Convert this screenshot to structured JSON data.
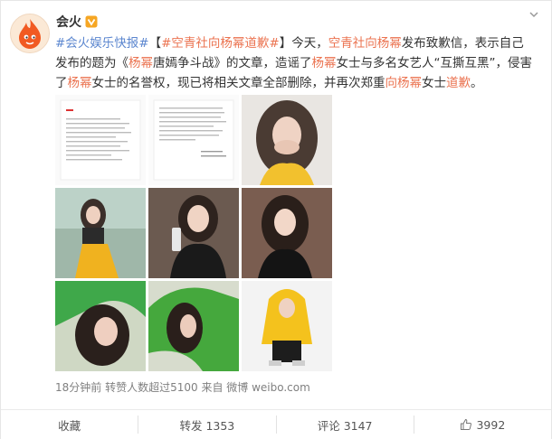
{
  "post": {
    "username": "会火",
    "text_segments": [
      {
        "t": "#会火娱乐快报#",
        "cls": "tag blue"
      },
      {
        "t": "【",
        "cls": ""
      },
      {
        "t": "#空青社向杨幂道歉#",
        "cls": "tag"
      },
      {
        "t": "】今天，",
        "cls": ""
      },
      {
        "t": "空青社向杨幂",
        "cls": "hl-link"
      },
      {
        "t": "发布致歉信，表示自己发布的题为《",
        "cls": ""
      },
      {
        "t": "杨幂",
        "cls": "hl-link"
      },
      {
        "t": "唐嫣争斗战》的文章，造谣了",
        "cls": ""
      },
      {
        "t": "杨幂",
        "cls": "hl-link"
      },
      {
        "t": "女士与多名女艺人“互撕互黑”，侵害了",
        "cls": ""
      },
      {
        "t": "杨幂",
        "cls": "hl-link"
      },
      {
        "t": "女士的名誉权，现已将相关文章全部删除，并再次郑重",
        "cls": ""
      },
      {
        "t": "向杨幂",
        "cls": "hl-link"
      },
      {
        "t": "女士",
        "cls": ""
      },
      {
        "t": "道歉",
        "cls": "hl-link"
      },
      {
        "t": "。",
        "cls": ""
      }
    ],
    "meta": "18分钟前 转赞人数超过5100 来自 微博 weibo.com",
    "images": [
      {
        "name": "image-letter-page-1"
      },
      {
        "name": "image-letter-page-2"
      },
      {
        "name": "image-photo-3"
      },
      {
        "name": "image-photo-4"
      },
      {
        "name": "image-photo-5"
      },
      {
        "name": "image-photo-6"
      },
      {
        "name": "image-photo-7"
      },
      {
        "name": "image-photo-8"
      },
      {
        "name": "image-photo-9"
      }
    ]
  },
  "footer": {
    "collect_label": "收藏",
    "repost_label": "转发 1353",
    "comment_label": "评论 3147",
    "like_count": "3992"
  },
  "colors": {
    "accent": "#eb7350",
    "tag_blue": "#5b86cf",
    "verify": "#f6a623"
  },
  "icons": {
    "avatar": "flame-logo-icon",
    "verify": "verified-v-icon",
    "menu": "chevron-down-icon",
    "like": "thumbs-up-icon"
  }
}
